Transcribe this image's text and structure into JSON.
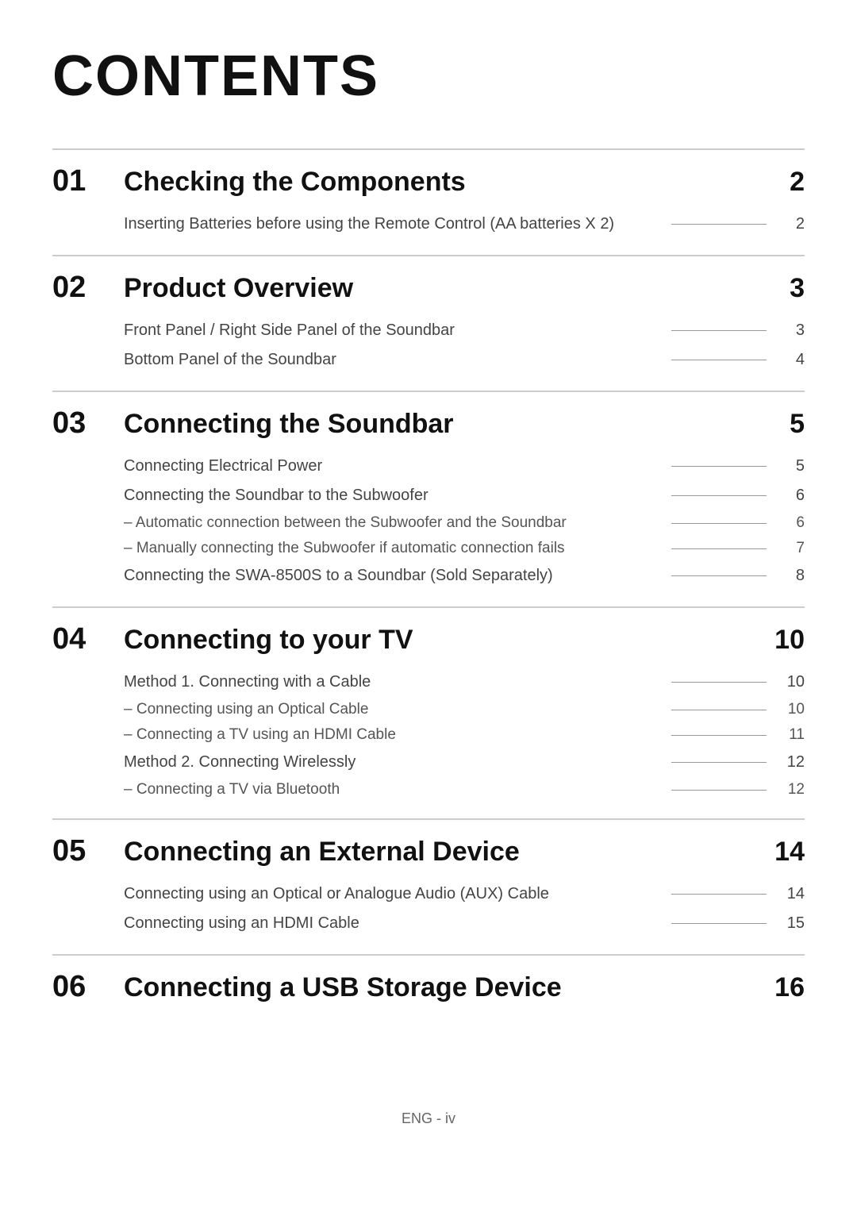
{
  "title": "CONTENTS",
  "sections": [
    {
      "number": "01",
      "title": "Checking the Components",
      "page": "2",
      "entries": [
        {
          "text": "Inserting Batteries before using the Remote Control (AA batteries X 2)",
          "page": "2",
          "subentries": []
        }
      ]
    },
    {
      "number": "02",
      "title": "Product Overview",
      "page": "3",
      "entries": [
        {
          "text": "Front Panel / Right Side Panel of the Soundbar",
          "page": "3",
          "subentries": []
        },
        {
          "text": "Bottom Panel of the Soundbar",
          "page": "4",
          "subentries": []
        }
      ]
    },
    {
      "number": "03",
      "title": "Connecting the Soundbar",
      "page": "5",
      "entries": [
        {
          "text": "Connecting Electrical Power",
          "page": "5",
          "subentries": []
        },
        {
          "text": "Connecting the Soundbar to the Subwoofer",
          "page": "6",
          "subentries": [
            {
              "text": "–  Automatic connection between the Subwoofer and the Soundbar",
              "page": "6"
            },
            {
              "text": "–  Manually connecting the Subwoofer if automatic connection fails",
              "page": "7"
            }
          ]
        },
        {
          "text": "Connecting the SWA-8500S to a Soundbar (Sold Separately)",
          "page": "8",
          "subentries": []
        }
      ]
    },
    {
      "number": "04",
      "title": "Connecting to your TV",
      "page": "10",
      "entries": [
        {
          "text": "Method 1. Connecting with a Cable",
          "page": "10",
          "subentries": [
            {
              "text": "–  Connecting using an Optical Cable",
              "page": "10"
            },
            {
              "text": "–  Connecting a TV using an HDMI Cable",
              "page": "11"
            }
          ]
        },
        {
          "text": "Method 2. Connecting Wirelessly",
          "page": "12",
          "subentries": [
            {
              "text": "–  Connecting a TV via Bluetooth",
              "page": "12"
            }
          ]
        }
      ]
    },
    {
      "number": "05",
      "title": "Connecting an External Device",
      "page": "14",
      "entries": [
        {
          "text": "Connecting using an Optical or Analogue Audio (AUX) Cable",
          "page": "14",
          "subentries": []
        },
        {
          "text": "Connecting using an HDMI Cable",
          "page": "15",
          "subentries": []
        }
      ]
    },
    {
      "number": "06",
      "title": "Connecting a USB Storage Device",
      "page": "16",
      "entries": []
    }
  ],
  "footer": "ENG - iv"
}
